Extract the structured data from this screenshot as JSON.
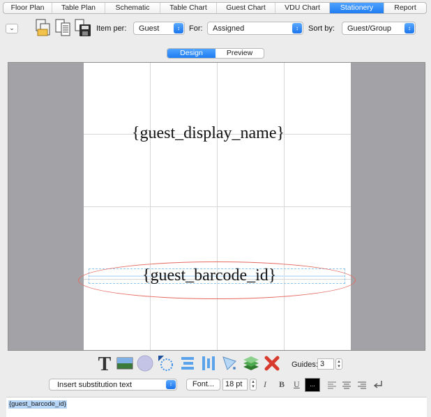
{
  "tabs": [
    "Floor Plan",
    "Table Plan",
    "Schematic",
    "Table Chart",
    "Guest Chart",
    "VDU Chart",
    "Stationery",
    "Report"
  ],
  "active_tab": "Stationery",
  "toolbar": {
    "item_per_label": "Item per:",
    "item_per_value": "Guest",
    "for_label": "For:",
    "for_value": "Assigned",
    "sort_by_label": "Sort by:",
    "sort_by_value": "Guest/Group"
  },
  "view_tabs": {
    "design": "Design",
    "preview": "Preview"
  },
  "canvas": {
    "field_name": "{guest_display_name}",
    "field_barcode": "{guest_barcode_id}"
  },
  "tools": {
    "guides_label": "Guides:",
    "guides_value": "3",
    "insert_text": "Insert substitution text",
    "font_button": "Font...",
    "font_size": "18 pt",
    "color_well": "...",
    "italic": "I",
    "bold": "B",
    "underline": "U"
  },
  "editor_text": "{guest_barcode_id}",
  "icons": [
    "copy-icon",
    "list-icon",
    "save-icon",
    "text-tool-icon",
    "image-tool-icon",
    "circle-tool-icon",
    "dotted-circle-tool-icon",
    "align-horizontal-icon",
    "align-vertical-icon",
    "paint-bucket-icon",
    "layers-icon",
    "delete-icon",
    "return-icon"
  ],
  "colors": {
    "accent": "#1f7df2",
    "selection_oval": "#e4685f",
    "guide_box": "#8ec6f0"
  }
}
